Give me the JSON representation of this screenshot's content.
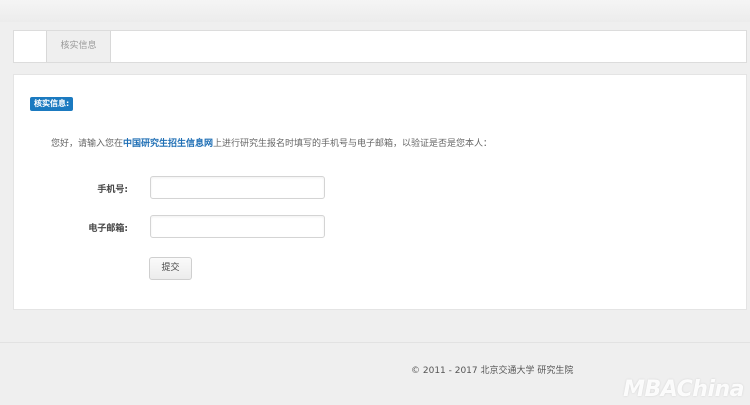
{
  "tabs": [
    {
      "label": "核实信息"
    }
  ],
  "section_badge": "核实信息:",
  "intro": {
    "prefix": "您好，请输入您在",
    "link": "中国研究生招生信息网",
    "suffix": "上进行研究生报名时填写的手机号与电子邮箱，以验证是否是您本人："
  },
  "form": {
    "phone_label": "手机号:",
    "phone_value": "",
    "email_label": "电子邮箱:",
    "email_value": "",
    "submit_label": "提交"
  },
  "footer": "© 2011 - 2017 北京交通大学 研究生院",
  "watermark": "MBAChina"
}
